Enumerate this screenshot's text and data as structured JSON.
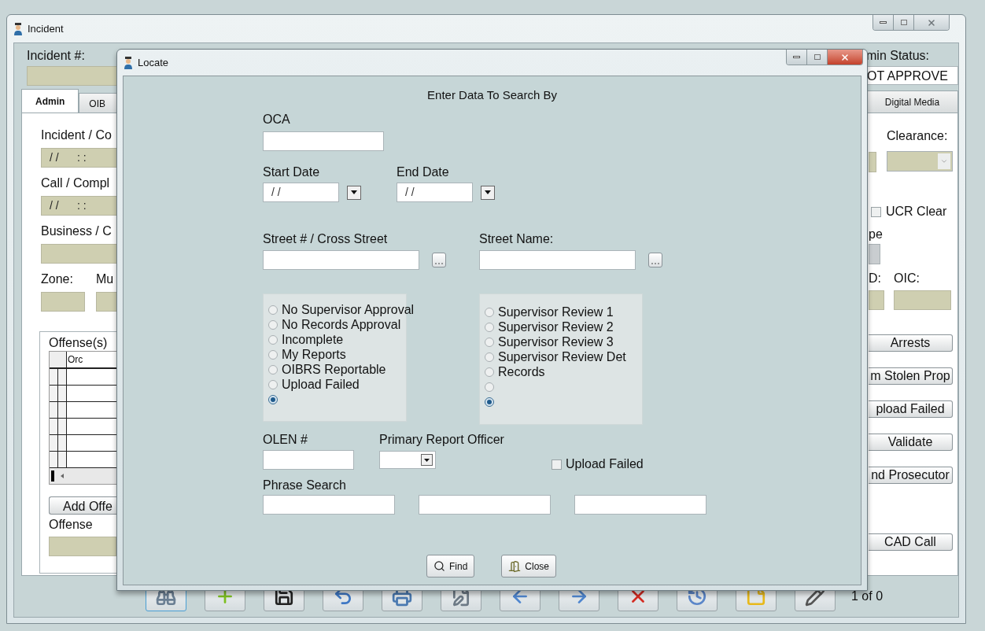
{
  "incident_window": {
    "title": "Incident",
    "incident_number": {
      "label": "Incident #:"
    },
    "admin_status": {
      "label": "min Status:",
      "value": "OT APPROVE"
    },
    "tabs_left": [
      {
        "label": "Admin",
        "selected": true
      },
      {
        "label": "OIB",
        "selected": false
      }
    ],
    "tabs_right": [
      {
        "label": "Digital Media",
        "selected": false
      }
    ],
    "left_fields": [
      {
        "label": "Incident / Co",
        "value": "/ /      : :"
      },
      {
        "label": "Call / Compl",
        "value": "/ /      : :"
      },
      {
        "label": "Business / C"
      }
    ],
    "zone_row": [
      {
        "label": "Zone:"
      },
      {
        "label": "Mu"
      }
    ],
    "offenses": {
      "title": "Offense(s)",
      "column": "Orc",
      "add_button": "Add Offe",
      "offense_label": "Offense"
    },
    "clearance": {
      "label": "Clearance:"
    },
    "ucr_clear": {
      "label": "UCR Clear",
      "checked": false
    },
    "type_label": "pe",
    "officer_row": [
      {
        "label": "D:"
      },
      {
        "label": "OIC:"
      }
    ],
    "side_buttons": [
      "Arrests",
      "m Stolen Prop",
      "pload Failed",
      "Validate",
      "nd Prosecutor",
      "CAD Call"
    ],
    "record_count": "1 of 0"
  },
  "locate_dialog": {
    "title": "Locate",
    "heading": "Enter Data To Search By",
    "oca": {
      "label": "OCA"
    },
    "start_date": {
      "label": "Start Date",
      "value": "/ /"
    },
    "end_date": {
      "label": "End Date",
      "value": "/ /"
    },
    "street_number": {
      "label": "Street # / Cross Street"
    },
    "street_name": {
      "label": "Street Name:"
    },
    "radio_groups": [
      [
        {
          "label": "No Supervisor Approval",
          "selected": false
        },
        {
          "label": "No Records Approval",
          "selected": false
        },
        {
          "label": "Incomplete",
          "selected": false
        },
        {
          "label": "My Reports",
          "selected": false
        },
        {
          "label": "OIBRS Reportable",
          "selected": false
        },
        {
          "label": "Upload Failed",
          "selected": false
        },
        {
          "selected": true
        }
      ],
      [
        {
          "label": "Supervisor Review 1",
          "selected": false
        },
        {
          "label": "Supervisor Review 2",
          "selected": false
        },
        {
          "label": "Supervisor Review 3",
          "selected": false
        },
        {
          "label": "Supervisor Review Det",
          "selected": false
        },
        {
          "label": "Records",
          "selected": false
        },
        {
          "selected": false
        },
        {
          "selected": true
        }
      ]
    ],
    "olen": {
      "label": "OLEN #"
    },
    "primary_officer": {
      "label": "Primary Report Officer"
    },
    "upload_failed": {
      "label": "Upload Failed",
      "checked": false
    },
    "phrase_search": {
      "label": "Phrase Search"
    },
    "buttons": [
      {
        "kind": "find",
        "label": "Find"
      },
      {
        "kind": "close",
        "label": "Close"
      }
    ]
  }
}
